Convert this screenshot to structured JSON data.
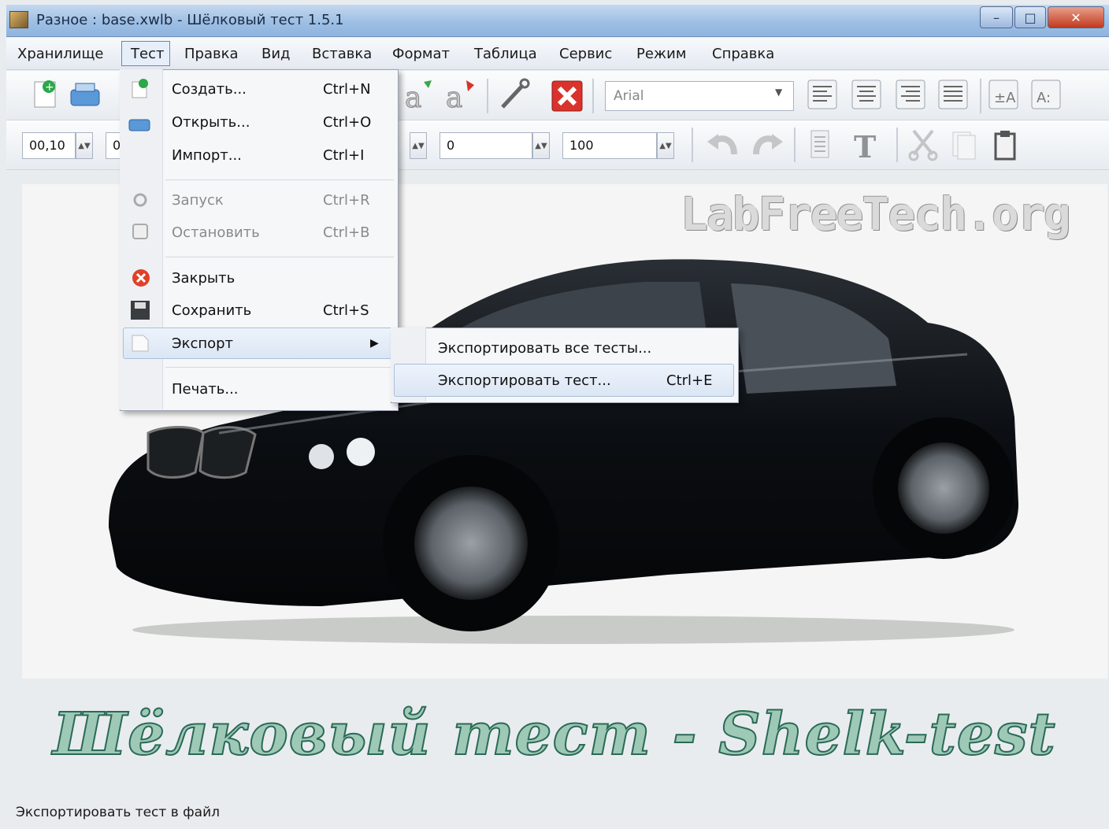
{
  "window": {
    "title": "Разное : base.xwlb - Шёлковый тест 1.5.1",
    "minimize_symbol": "–",
    "maximize_symbol": "□",
    "close_symbol": "✕"
  },
  "menubar": {
    "items": [
      "Хранилище",
      "Тест",
      "Правка",
      "Вид",
      "Вставка",
      "Формат",
      "Таблица",
      "Сервис",
      "Режим",
      "Справка"
    ],
    "active": "Тест"
  },
  "toolbar": {
    "font_name": "Arial",
    "spin_values": [
      "00,10",
      "0",
      "0",
      "100"
    ],
    "icons": [
      "new-test-icon",
      "open-icon",
      "font-color-icon",
      "font-highlight-icon",
      "wrench-icon",
      "delete-icon",
      "align-left-icon",
      "align-center-icon",
      "align-right-icon",
      "align-justify-icon",
      "superscript-icon",
      "subscript-icon",
      "undo-icon",
      "redo-icon",
      "list-icon",
      "text-icon",
      "cut-icon",
      "copy-icon",
      "paste-icon"
    ]
  },
  "test_menu": {
    "items": [
      {
        "label": "Создать...",
        "shortcut": "Ctrl+N",
        "icon": "new-icon",
        "enabled": true
      },
      {
        "label": "Открыть...",
        "shortcut": "Ctrl+O",
        "icon": "open-icon",
        "enabled": true
      },
      {
        "label": "Импорт...",
        "shortcut": "Ctrl+I",
        "icon": "",
        "enabled": true
      },
      {
        "label": "Запуск",
        "shortcut": "Ctrl+R",
        "icon": "run-icon",
        "enabled": false
      },
      {
        "label": "Остановить",
        "shortcut": "Ctrl+B",
        "icon": "stop-icon",
        "enabled": false
      },
      {
        "label": "Закрыть",
        "shortcut": "",
        "icon": "close-icon",
        "enabled": true
      },
      {
        "label": "Сохранить",
        "shortcut": "Ctrl+S",
        "icon": "save-icon",
        "enabled": true
      },
      {
        "label": "Экспорт",
        "shortcut": "",
        "icon": "export-icon",
        "enabled": true,
        "submenu": true
      },
      {
        "label": "Печать...",
        "shortcut": "",
        "icon": "",
        "enabled": true
      }
    ]
  },
  "export_submenu": {
    "items": [
      {
        "label": "Экспортировать все тесты...",
        "shortcut": ""
      },
      {
        "label": "Экспортировать тест...",
        "shortcut": "Ctrl+E"
      }
    ]
  },
  "content": {
    "watermark": "LabFreeTech.org",
    "banner": "Шёлковый тест - Shelk-test"
  },
  "statusbar": {
    "text": "Экспортировать тест в файл"
  }
}
